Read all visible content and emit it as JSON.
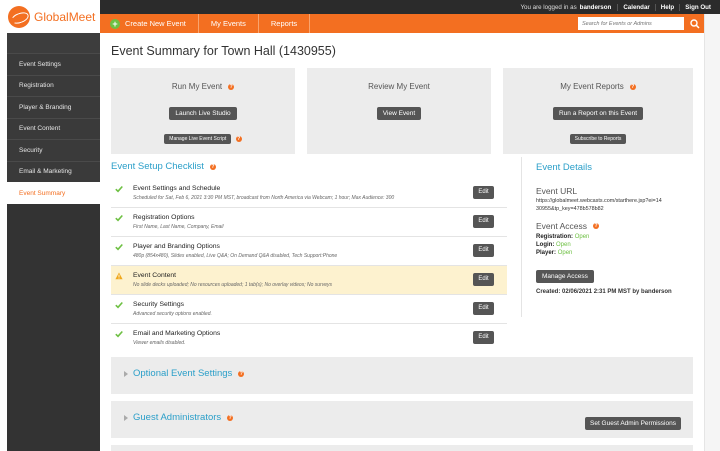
{
  "brand": {
    "name": "GlobalMeet",
    "accent": "#f36f21",
    "link": "#2b9fc9",
    "ok": "#6ec043"
  },
  "topbar": {
    "logged_in_label": "You are logged in as",
    "username": "banderson",
    "links": [
      "Calendar",
      "Help",
      "Sign Out"
    ]
  },
  "nav": {
    "create_label": "Create New Event",
    "items": [
      "My Events",
      "Reports"
    ],
    "search_placeholder": "Search for Events or Admins"
  },
  "sidebar": {
    "items": [
      {
        "label": "Event Settings",
        "active": false
      },
      {
        "label": "Registration",
        "active": false
      },
      {
        "label": "Player & Branding",
        "active": false
      },
      {
        "label": "Event Content",
        "active": false
      },
      {
        "label": "Security",
        "active": false
      },
      {
        "label": "Email & Marketing",
        "active": false
      },
      {
        "label": "Event Summary",
        "active": true
      }
    ]
  },
  "page": {
    "title": "Event Summary for Town Hall (1430955)"
  },
  "panels": [
    {
      "title": "Run My Event",
      "button": "Launch Live Studio",
      "secondary": "Manage Live Event Script"
    },
    {
      "title": "Review My Event",
      "button": "View Event"
    },
    {
      "title": "My Event Reports",
      "button": "Run a Report on this Event",
      "secondary": "Subscribe to Reports"
    }
  ],
  "checklist": {
    "title": "Event Setup Checklist",
    "edit_label": "Edit",
    "rows": [
      {
        "title": "Event Settings and Schedule",
        "sub": "Scheduled for Sat, Feb 6, 2021 3:30 PM MST, broadcast from North America via Webcam; 1 hour; Max Audience: 300",
        "status": "ok"
      },
      {
        "title": "Registration Options",
        "sub": "First Name, Last Name, Company, Email",
        "status": "ok"
      },
      {
        "title": "Player and Branding Options",
        "sub": "480p (854x480), Slides enabled, Live Q&A; On Demand Q&A disabled, Tech Support:Phone",
        "status": "ok"
      },
      {
        "title": "Event Content",
        "sub": "No slide decks uploaded; No resources uploaded; 1 tab(s); No overlay videos; No surveys",
        "status": "warn"
      },
      {
        "title": "Security Settings",
        "sub": "Advanced security options enabled.",
        "status": "ok"
      },
      {
        "title": "Email and Marketing Options",
        "sub": "Viewer emails disabled.",
        "status": "ok"
      }
    ]
  },
  "details": {
    "title": "Event Details",
    "url_label": "Event URL",
    "url": "https://globalmeet.webcasts.com/starthere.jsp?ei=1430955&tp_key=478b578b82",
    "access_label": "Event Access",
    "access": [
      {
        "key": "Registration:",
        "value": "Open"
      },
      {
        "key": "Login:",
        "value": "Open"
      },
      {
        "key": "Player:",
        "value": "Open"
      }
    ],
    "manage_button": "Manage Access",
    "created_label": "Created:",
    "created_value": "02/06/2021 2:31 PM MST by banderson"
  },
  "accordions": [
    {
      "title": "Optional Event Settings"
    },
    {
      "title": "Guest Administrators",
      "button": "Set Guest Admin Permissions"
    }
  ]
}
